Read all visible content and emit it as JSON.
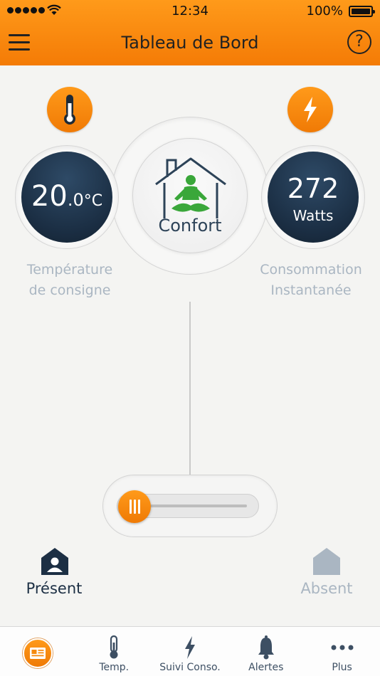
{
  "status": {
    "time": "12:34",
    "battery": "100%"
  },
  "header": {
    "title": "Tableau de Bord",
    "help": "?"
  },
  "temperature": {
    "value_int": "20",
    "value_dec": ".0",
    "unit": "°C",
    "label_line1": "Température",
    "label_line2": "de consigne"
  },
  "consumption": {
    "value": "272",
    "unit": "Watts",
    "label_line1": "Consommation",
    "label_line2": "Instantanée"
  },
  "mode": {
    "current": "Confort"
  },
  "presence": {
    "present_label": "Présent",
    "absent_label": "Absent",
    "selected": "present"
  },
  "tabs": [
    {
      "label": "",
      "icon": "dashboard-icon",
      "active": true
    },
    {
      "label": "Temp.",
      "icon": "thermometer-icon"
    },
    {
      "label": "Suivi Conso.",
      "icon": "lightning-icon"
    },
    {
      "label": "Alertes",
      "icon": "bell-icon"
    },
    {
      "label": "Plus",
      "icon": "more-icon"
    }
  ],
  "colors": {
    "accent": "#f58a0f",
    "dark_disc": "#1c2f44",
    "green": "#3aa73a",
    "label_grey": "#aab6c2",
    "tab_text": "#3d4f63"
  }
}
